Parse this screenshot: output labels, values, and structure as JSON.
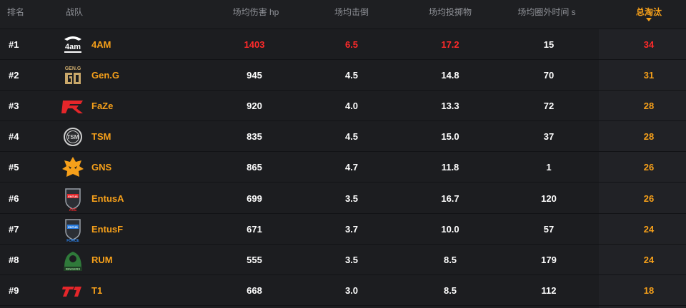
{
  "headers": {
    "rank": "排名",
    "team": "战队",
    "damage": "场均伤害 hp",
    "kills": "场均击倒",
    "throws": "场均投掷物",
    "outside_time": "场均圈外时间 s",
    "total_kills": "总淘汰"
  },
  "colors": {
    "accent": "#f6a01a",
    "leader": "#ff2a2a",
    "text": "#ffffff",
    "muted": "#8e9096"
  },
  "rows": [
    {
      "rank": "#1",
      "team": "4AM",
      "logo": "4am-logo-icon",
      "damage": "1403",
      "kills": "6.5",
      "throws": "17.2",
      "outside": "15",
      "total": "34"
    },
    {
      "rank": "#2",
      "team": "Gen.G",
      "logo": "geng-logo-icon",
      "damage": "945",
      "kills": "4.5",
      "throws": "14.8",
      "outside": "70",
      "total": "31"
    },
    {
      "rank": "#3",
      "team": "FaZe",
      "logo": "faze-logo-icon",
      "damage": "920",
      "kills": "4.0",
      "throws": "13.3",
      "outside": "72",
      "total": "28"
    },
    {
      "rank": "#4",
      "team": "TSM",
      "logo": "tsm-logo-icon",
      "damage": "835",
      "kills": "4.5",
      "throws": "15.0",
      "outside": "37",
      "total": "28"
    },
    {
      "rank": "#5",
      "team": "GNS",
      "logo": "gns-logo-icon",
      "damage": "865",
      "kills": "4.7",
      "throws": "11.8",
      "outside": "1",
      "total": "26"
    },
    {
      "rank": "#6",
      "team": "EntusA",
      "logo": "entusa-logo-icon",
      "damage": "699",
      "kills": "3.5",
      "throws": "16.7",
      "outside": "120",
      "total": "26"
    },
    {
      "rank": "#7",
      "team": "EntusF",
      "logo": "entusf-logo-icon",
      "damage": "671",
      "kills": "3.7",
      "throws": "10.0",
      "outside": "57",
      "total": "24"
    },
    {
      "rank": "#8",
      "team": "RUM",
      "logo": "rum-logo-icon",
      "damage": "555",
      "kills": "3.5",
      "throws": "8.5",
      "outside": "179",
      "total": "24"
    },
    {
      "rank": "#9",
      "team": "T1",
      "logo": "t1-logo-icon",
      "damage": "668",
      "kills": "3.0",
      "throws": "8.5",
      "outside": "112",
      "total": "18"
    }
  ],
  "logo_labels": {
    "4am": "4am",
    "geng_top": "GEN.G",
    "entus_ace": "ACE",
    "entus_force": "FORCE",
    "rum_bottom": "RINGERS"
  }
}
